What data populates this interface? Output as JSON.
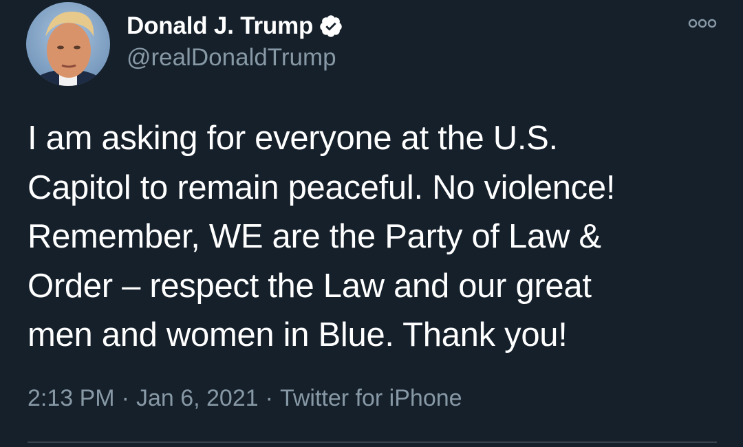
{
  "tweet": {
    "author": {
      "display_name": "Donald J. Trump",
      "handle": "@realDonaldTrump",
      "verified": true
    },
    "text": "I am asking for everyone at the U.S.\nCapitol to remain peaceful. No violence!\nRemember, WE are the Party of Law &\nOrder – respect the Law and our great\nmen and women in Blue. Thank you!",
    "meta": {
      "time": "2:13 PM",
      "date": "Jan 6, 2021",
      "source": "Twitter for iPhone",
      "separator": "·"
    }
  },
  "icons": {
    "verified": "verified-badge-icon",
    "more": "more-options-icon"
  },
  "colors": {
    "background": "#15202b",
    "text_primary": "#ffffff",
    "text_secondary": "#8899a6",
    "divider": "#38444d"
  }
}
